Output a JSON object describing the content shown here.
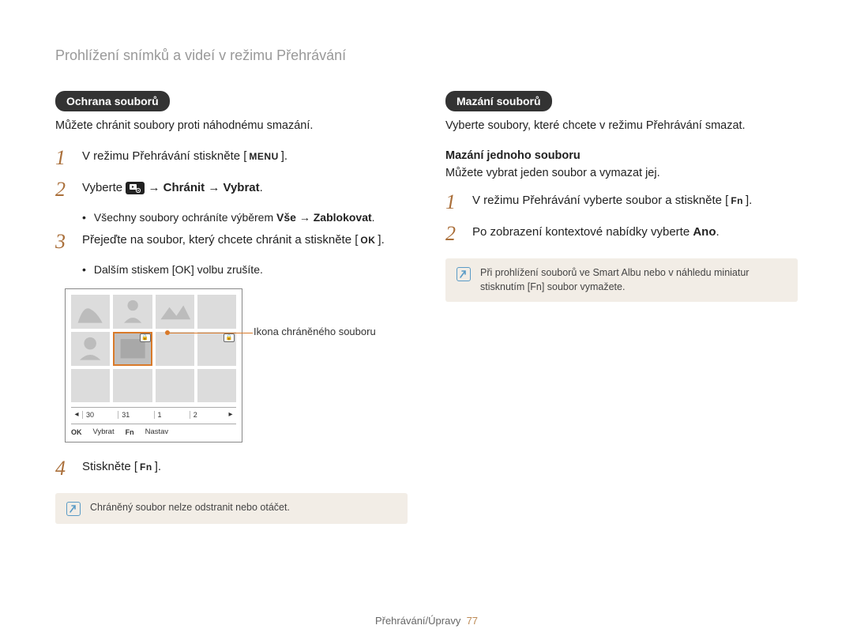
{
  "page_title": "Prohlížení snímků a videí v režimu Přehrávání",
  "left": {
    "section_pill": "Ochrana souborů",
    "section_desc": "Můžete chránit soubory proti náhodnému smazání.",
    "step1": {
      "pre": "V režimu Přehrávání stiskněte [",
      "key": "MENU",
      "post": "]."
    },
    "step2": {
      "pre": "Vyberte ",
      "bold": "Chránit",
      "mid": " → ",
      "bold2": "Vybrat",
      "post": "."
    },
    "bullet2": {
      "pre": "Všechny soubory ochráníte výběrem ",
      "bold": "Vše",
      "mid": " → ",
      "bold2": "Zablokovat",
      "post": "."
    },
    "step3": {
      "pre": "Přejeďte na soubor, který chcete chránit a stiskněte [",
      "key": "OK",
      "post": "]."
    },
    "bullet3": {
      "pre": "Dalším stiskem [",
      "key": "OK",
      "post": "] volbu zrušíte."
    },
    "callout": "Ikona chráněného souboru",
    "timeline": {
      "d1": "30",
      "d2": "31",
      "d3": "1",
      "d4": "2"
    },
    "bottombar": {
      "ok": "OK",
      "oklabel": "Vybrat",
      "fn": "Fn",
      "fnlabel": "Nastav"
    },
    "step4": {
      "pre": "Stiskněte [",
      "key": "Fn",
      "post": "]."
    },
    "note": "Chráněný soubor nelze odstranit nebo otáčet."
  },
  "right": {
    "section_pill": "Mazání souborů",
    "section_desc": "Vyberte soubory, které chcete v režimu Přehrávání smazat.",
    "sub_heading": "Mazání jednoho souboru",
    "sub_desc": "Můžete vybrat jeden soubor a vymazat jej.",
    "step1": {
      "pre": "V režimu Přehrávání vyberte soubor a stiskněte [",
      "key": "Fn",
      "post": "]."
    },
    "step2": {
      "pre": "Po zobrazení kontextové nabídky vyberte ",
      "bold": "Ano",
      "post": "."
    },
    "note_pre": "Při prohlížení souborů ve Smart Albu nebo v náhledu miniatur stisknutím [",
    "note_key": "Fn",
    "note_post": "] soubor vymažete."
  },
  "footer": {
    "section": "Přehrávání/Úpravy",
    "page": "77"
  }
}
